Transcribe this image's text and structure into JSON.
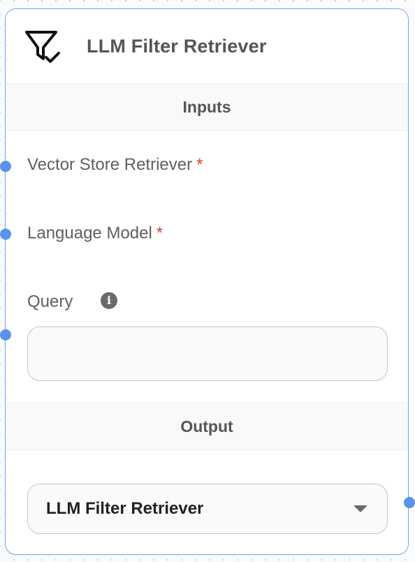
{
  "node": {
    "title": "LLM Filter Retriever",
    "icon": "filter-check-icon",
    "inputs_header": "Inputs",
    "output_header": "Output",
    "inputs": [
      {
        "label": "Vector Store Retriever",
        "required": "*"
      },
      {
        "label": "Language Model",
        "required": "*"
      },
      {
        "label": "Query",
        "info_icon": "info-icon"
      }
    ],
    "query_input": {
      "value": "",
      "placeholder": ""
    },
    "output_select": {
      "value": "LLM Filter Retriever"
    }
  },
  "colors": {
    "border": "#6ea5ec",
    "handle": "#5b93e8",
    "required": "#d2442e",
    "section_bg": "#f9f9f9"
  }
}
